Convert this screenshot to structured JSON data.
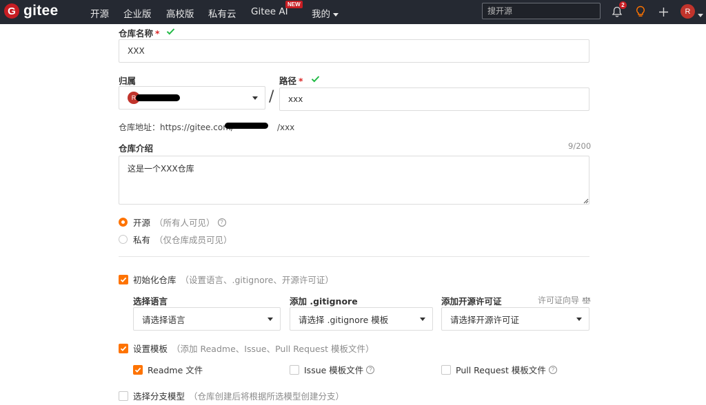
{
  "nav": {
    "logo_mark": "G",
    "logo_text": "gitee",
    "links": [
      "开源",
      "企业版",
      "高校版",
      "私有云",
      "Gitee AI",
      "我的"
    ],
    "new_badge": "NEW",
    "search_placeholder": "搜开源",
    "notification_count": "2",
    "avatar_letter": "R",
    "icons": [
      "bell-icon",
      "lightbulb-icon",
      "plus-icon"
    ]
  },
  "form": {
    "repo_name": {
      "label": "仓库名称",
      "required_mark": "*",
      "value": "XXX"
    },
    "owner": {
      "label": "归属",
      "avatar_letter": "R"
    },
    "separator": "/",
    "path": {
      "label": "路径",
      "required_mark": "*",
      "value": "xxx"
    },
    "address": {
      "prefix": "仓库地址：https://gitee.com/",
      "suffix": "/xxx"
    },
    "intro": {
      "label": "仓库介绍",
      "counter": "9/200",
      "value": "这是一个XXX仓库"
    },
    "visibility": {
      "options": [
        {
          "label": "开源",
          "hint": "（所有人可见）",
          "selected": true
        },
        {
          "label": "私有",
          "hint": "（仅仓库成员可见）",
          "selected": false
        }
      ]
    },
    "init_repo": {
      "label": "初始化仓库",
      "hint": "（设置语言、.gitignore、开源许可证）",
      "checked": true,
      "language": {
        "label": "选择语言",
        "placeholder": "请选择语言"
      },
      "gitignore": {
        "label": "添加 .gitignore",
        "placeholder": "请选择 .gitignore 模板"
      },
      "license": {
        "label": "添加开源许可证",
        "placeholder": "请选择开源许可证",
        "guide": "许可证向导"
      }
    },
    "templates": {
      "label": "设置模板",
      "hint": "（添加 Readme、Issue、Pull Request 模板文件）",
      "checked": true,
      "options": [
        {
          "label": "Readme 文件",
          "checked": true
        },
        {
          "label": "Issue 模板文件",
          "checked": false
        },
        {
          "label": "Pull Request 模板文件",
          "checked": false
        }
      ]
    },
    "branch_model": {
      "label": "选择分支模型",
      "hint": "（仓库创建后将根据所选模型创建分支）",
      "checked": false
    }
  },
  "colors": {
    "accent": "#fe7300",
    "nav_bg": "#252932",
    "brand": "#c71d23",
    "check_green": "#21ba45"
  }
}
